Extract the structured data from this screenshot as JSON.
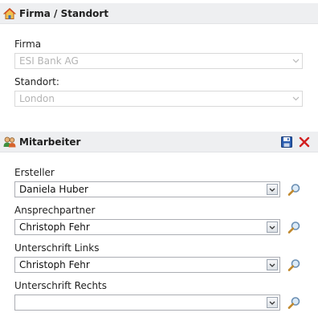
{
  "company_panel": {
    "title": "Firma / Standort",
    "icon": "home-icon",
    "company_label": "Firma",
    "company_value": "ESI Bank AG",
    "location_label": "Standort:",
    "location_value": "London"
  },
  "employee_panel": {
    "title": "Mitarbeiter",
    "icon": "people-icon",
    "save_icon": "save-icon",
    "close_icon": "close-icon",
    "creator_label": "Ersteller",
    "creator_value": "Daniela Huber",
    "contact_label": "Ansprechpartner",
    "contact_value": "Christoph Fehr",
    "signature_left_label": "Unterschrift Links",
    "signature_left_value": "Christoph Fehr",
    "signature_right_label": "Unterschrift Rechts",
    "signature_right_value": ""
  },
  "colors": {
    "header_bg": "#eeeff1",
    "close_red": "#d22020",
    "save_blue": "#2a5db0"
  }
}
